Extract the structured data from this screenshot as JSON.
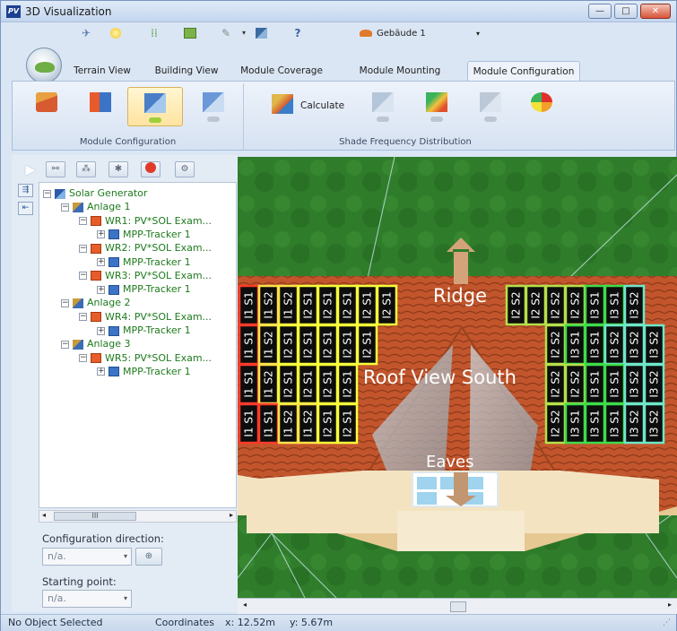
{
  "window": {
    "title": "3D Visualization",
    "app_icon_text": "PV",
    "controls": [
      "—",
      "□",
      "✕"
    ]
  },
  "quick_access": {
    "building_selector": "Gebäude 1"
  },
  "tabs": [
    {
      "label": "Terrain View",
      "active": false
    },
    {
      "label": "Building View",
      "active": false
    },
    {
      "label": "Module Coverage",
      "active": false
    },
    {
      "label": "Module Mounting",
      "active": false
    },
    {
      "label": "Module Configuration",
      "active": true
    }
  ],
  "ribbon": {
    "group1_label": "Module Configuration",
    "group2_label": "Shade Frequency Distribution",
    "calculate_label": "Calculate"
  },
  "tree": [
    {
      "label": "Solar Generator",
      "level": 0,
      "icon": "solar-generator-icon",
      "expander": "−"
    },
    {
      "label": "Anlage 1",
      "level": 1,
      "icon": "system-icon",
      "expander": "−"
    },
    {
      "label": "WR1:  PV*SOL Exam...",
      "level": 2,
      "icon": "inverter-icon",
      "expander": "−"
    },
    {
      "label": "MPP-Tracker 1",
      "level": 3,
      "icon": "mpp-tracker-icon",
      "expander": "+"
    },
    {
      "label": "WR2:  PV*SOL Exam...",
      "level": 2,
      "icon": "inverter-icon",
      "expander": "−"
    },
    {
      "label": "MPP-Tracker 1",
      "level": 3,
      "icon": "mpp-tracker-icon",
      "expander": "+"
    },
    {
      "label": "WR3:  PV*SOL Exam...",
      "level": 2,
      "icon": "inverter-icon",
      "expander": "−"
    },
    {
      "label": "MPP-Tracker 1",
      "level": 3,
      "icon": "mpp-tracker-icon",
      "expander": "+"
    },
    {
      "label": "Anlage 2",
      "level": 1,
      "icon": "system-icon",
      "expander": "−"
    },
    {
      "label": "WR4:  PV*SOL Exam...",
      "level": 2,
      "icon": "inverter-icon",
      "expander": "−"
    },
    {
      "label": "MPP-Tracker 1",
      "level": 3,
      "icon": "mpp-tracker-icon",
      "expander": "+"
    },
    {
      "label": "Anlage 3",
      "level": 1,
      "icon": "system-icon",
      "expander": "−"
    },
    {
      "label": "WR5:  PV*SOL Exam...",
      "level": 2,
      "icon": "inverter-icon",
      "expander": "−"
    },
    {
      "label": "MPP-Tracker 1",
      "level": 3,
      "icon": "mpp-tracker-icon",
      "expander": "+"
    }
  ],
  "hscroll_thumb": "III",
  "config_direction": {
    "label": "Configuration direction:",
    "value": "n/a."
  },
  "starting_point": {
    "label": "Starting point:",
    "value": "n/a."
  },
  "view3d": {
    "ridge_label": "Ridge",
    "roof_label": "Roof View South",
    "eaves_label": "Eaves"
  },
  "panel_labels": {
    "left_columns": [
      [
        "I1 S1",
        "I1 S1",
        "I1 S1",
        "I1 S1"
      ],
      [
        "I1 S2",
        "I1 S2",
        "I1 S2",
        "I1 S1"
      ],
      [
        "I1 S2",
        "I2 S1",
        "I2 S1",
        "I1 S2"
      ],
      [
        "I2 S1",
        "I2 S1",
        "I2 S1",
        "I1 S2"
      ],
      [
        "I2 S1",
        "I2 S1",
        "I2 S1",
        "I2 S1"
      ],
      [
        "I2 S1",
        "I2 S1",
        "I2 S1",
        "I2 S1"
      ],
      [
        "I2 S1",
        "I2 S1",
        "",
        ""
      ],
      [
        "I2 S1",
        "",
        "",
        ""
      ]
    ],
    "right_columns": [
      [
        "I2 S2",
        "",
        "",
        ""
      ],
      [
        "I2 S2",
        "",
        "",
        ""
      ],
      [
        "I2 S2",
        "I2 S2",
        "I2 S2",
        "I2 S2"
      ],
      [
        "I2 S2",
        "I3 S1",
        "I2 S2",
        "I3 S1"
      ],
      [
        "I3 S1",
        "I3 S1",
        "I3 S1",
        "I3 S1"
      ],
      [
        "I3 S1",
        "I3 S2",
        "I3 S1",
        "I3 S1"
      ],
      [
        "I3 S2",
        "I3 S2",
        "I3 S2",
        "I3 S2"
      ],
      [
        "",
        "I3 S2",
        "I3 S2",
        "I3 S2"
      ]
    ]
  },
  "status": {
    "selection": "No Object Selected",
    "coords_label": "Coordinates",
    "x": "x: 12.52m",
    "y": "y: 5.67m"
  },
  "colors": {
    "accent": "#3b74c6",
    "tree_text": "#1e7a1e",
    "grass": "#2e7a2a",
    "roof": "#c4582f",
    "wall": "#f3e3c1"
  }
}
